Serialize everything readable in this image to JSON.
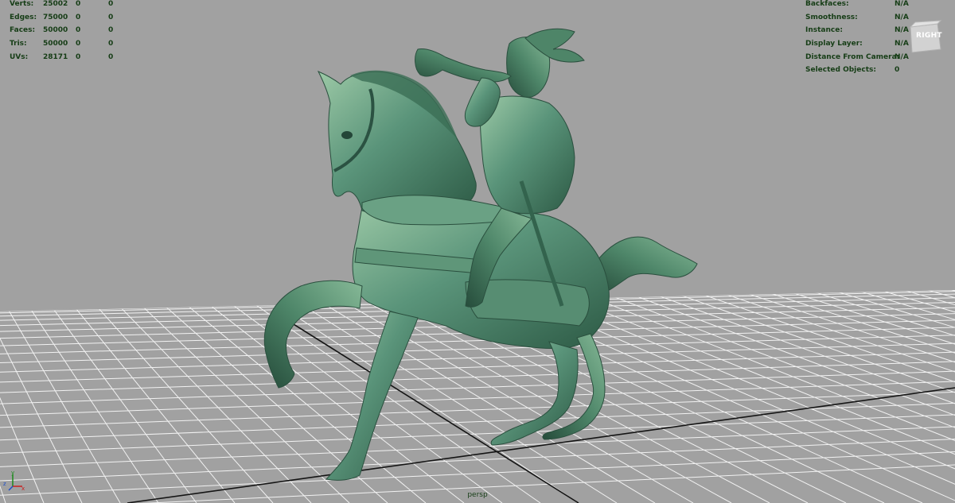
{
  "viewport": {
    "camera": "persp",
    "viewcube_face": "RIGHT",
    "background_color": "#a1a1a1",
    "grid_color": "#f2f2f2",
    "axis_line_color": "#111111"
  },
  "heads_up_left": {
    "rows": [
      {
        "label": "Verts:",
        "v1": "25002",
        "v2": "0",
        "v3": "0"
      },
      {
        "label": "Edges:",
        "v1": "75000",
        "v2": "0",
        "v3": "0"
      },
      {
        "label": "Faces:",
        "v1": "50000",
        "v2": "0",
        "v3": "0"
      },
      {
        "label": "Tris:",
        "v1": "50000",
        "v2": "0",
        "v3": "0"
      },
      {
        "label": "UVs:",
        "v1": "28171",
        "v2": "0",
        "v3": "0"
      }
    ]
  },
  "heads_up_right": {
    "rows": [
      {
        "label": "Backfaces:",
        "value": "N/A"
      },
      {
        "label": "Smoothness:",
        "value": "N/A"
      },
      {
        "label": "Instance:",
        "value": "N/A"
      },
      {
        "label": "Display Layer:",
        "value": "N/A"
      },
      {
        "label": "Distance From Camera:",
        "value": "N/A"
      },
      {
        "label": "Selected Objects:",
        "value": "0"
      }
    ]
  },
  "axis_indicator": {
    "x_label": "x",
    "y_label": "y",
    "z_label": "z"
  },
  "model": {
    "material_color": "#4f8a6a",
    "highlight_color": "#8fbf9a",
    "shadow_color": "#2c5642"
  }
}
